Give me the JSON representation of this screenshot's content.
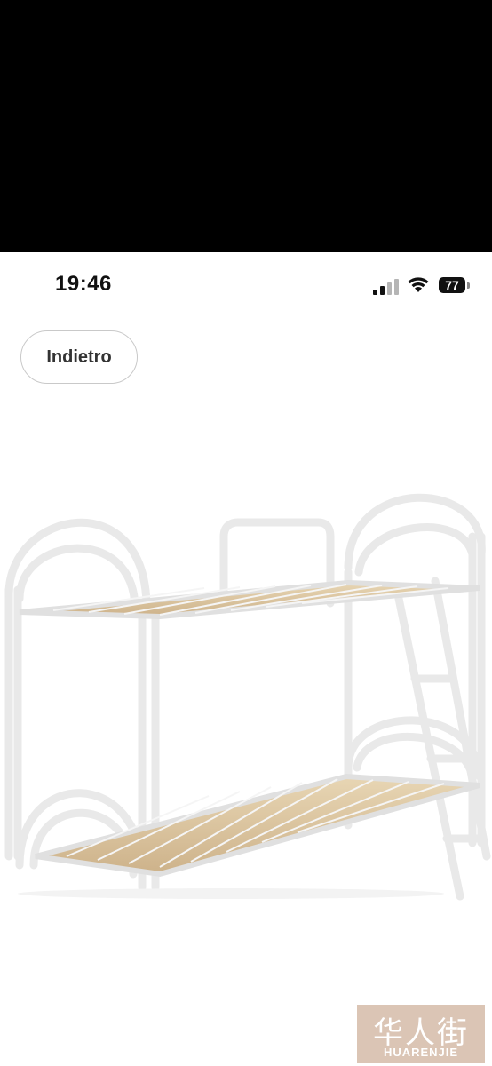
{
  "status_bar": {
    "time": "19:46",
    "battery": "77"
  },
  "nav": {
    "back_label": "Indietro"
  },
  "product": {
    "image": "white-metal-bunk-bed-with-wooden-slats"
  },
  "watermark": {
    "chars": "华人街",
    "text": "HUARENJIE"
  }
}
